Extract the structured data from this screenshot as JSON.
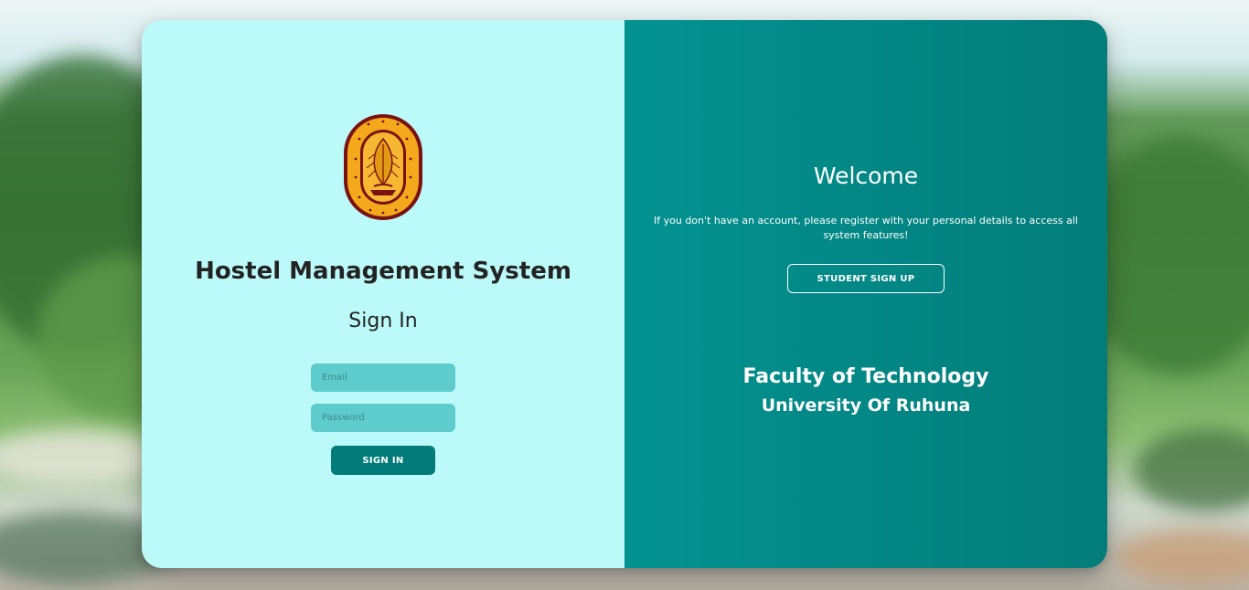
{
  "app": {
    "title": "Hostel Management System"
  },
  "signin": {
    "heading": "Sign In",
    "email_placeholder": "Email",
    "password_placeholder": "Password",
    "button_label": "SIGN IN"
  },
  "welcome_panel": {
    "heading": "Welcome",
    "message": "If you don't have an account, please register with your personal details to access all system features!",
    "signup_label": "STUDENT SIGN UP",
    "faculty": "Faculty of Technology",
    "university": "University Of Ruhuna"
  },
  "logo": {
    "icon": "university-crest-icon"
  },
  "colors": {
    "left_panel": "#bbfaf8",
    "right_panel": "#037d7a",
    "input_bg": "#5ecbcd",
    "primary_button": "#037c79",
    "crest_gold": "#f4a81c",
    "crest_maroon": "#7a1212"
  }
}
